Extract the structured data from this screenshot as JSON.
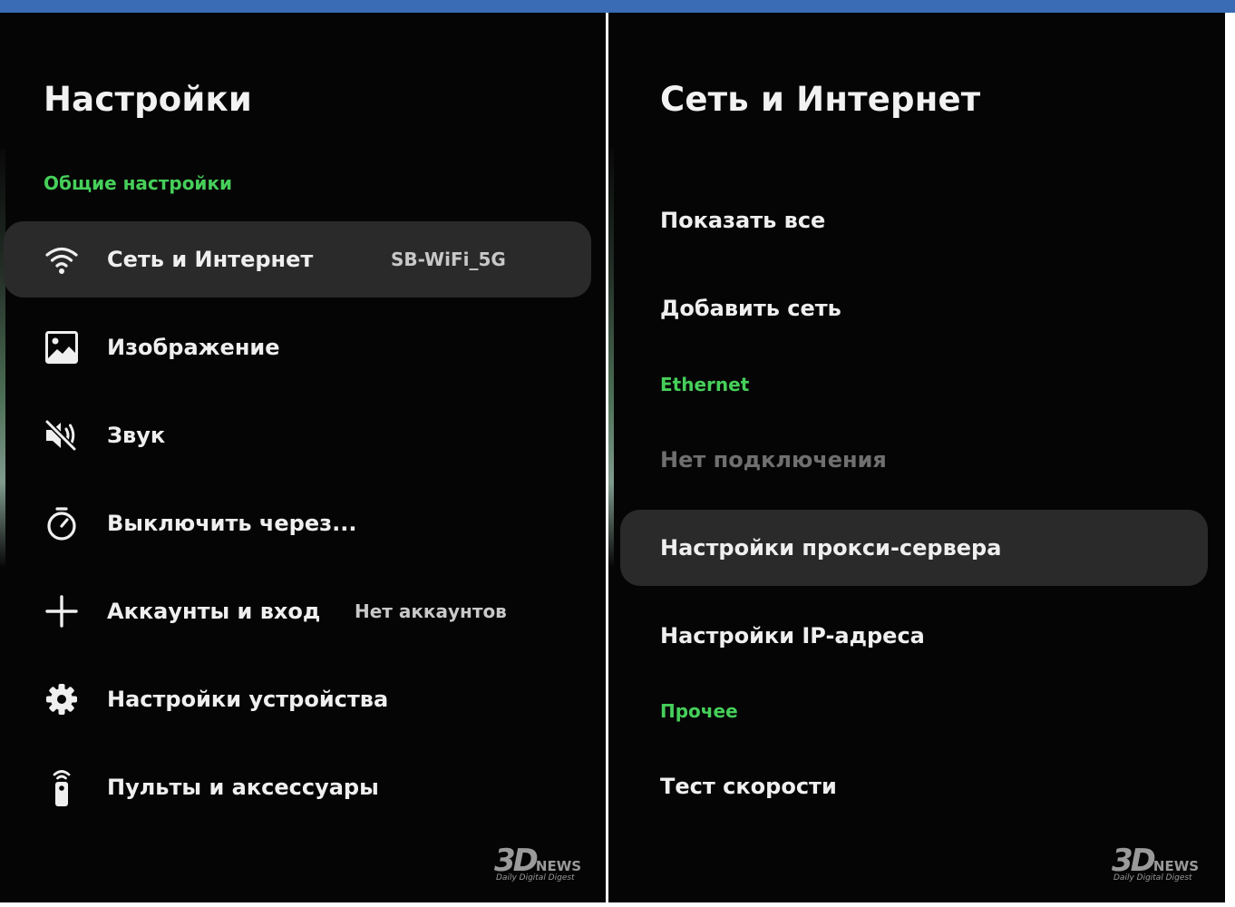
{
  "left_panel": {
    "title": "Настройки",
    "section": "Общие настройки",
    "items": [
      {
        "label": "Сеть и Интернет",
        "value": "SB-WiFi_5G",
        "icon": "wifi-icon",
        "selected": true
      },
      {
        "label": "Изображение",
        "value": "",
        "icon": "image-icon",
        "selected": false
      },
      {
        "label": "Звук",
        "value": "",
        "icon": "sound-muted-icon",
        "selected": false
      },
      {
        "label": "Выключить через...",
        "value": "",
        "icon": "timer-icon",
        "selected": false
      },
      {
        "label": "Аккаунты и вход",
        "value": "Нет аккаунтов",
        "icon": "plus-icon",
        "selected": false
      },
      {
        "label": "Настройки устройства",
        "value": "",
        "icon": "gear-icon",
        "selected": false
      },
      {
        "label": "Пульты и аксессуары",
        "value": "",
        "icon": "remote-icon",
        "selected": false
      }
    ]
  },
  "right_panel": {
    "title": "Сеть и Интернет",
    "items": {
      "show_all": "Показать все",
      "add_network": "Добавить сеть",
      "ethernet_section": "Ethernet",
      "no_connection": "Нет подключения",
      "proxy_settings": "Настройки прокси-сервера",
      "ip_settings": "Настройки IP-адреса",
      "other_section": "Прочее",
      "speed_test": "Тест скорости"
    }
  },
  "watermark": {
    "logo": "3D",
    "news": "NEWS",
    "tagline": "Daily Digital Digest"
  },
  "colors": {
    "background": "#050505",
    "accent_green": "#46cf5a",
    "selected_bg": "#2a2a2b",
    "text": "#efefef",
    "muted_text": "#6f6f6f"
  }
}
